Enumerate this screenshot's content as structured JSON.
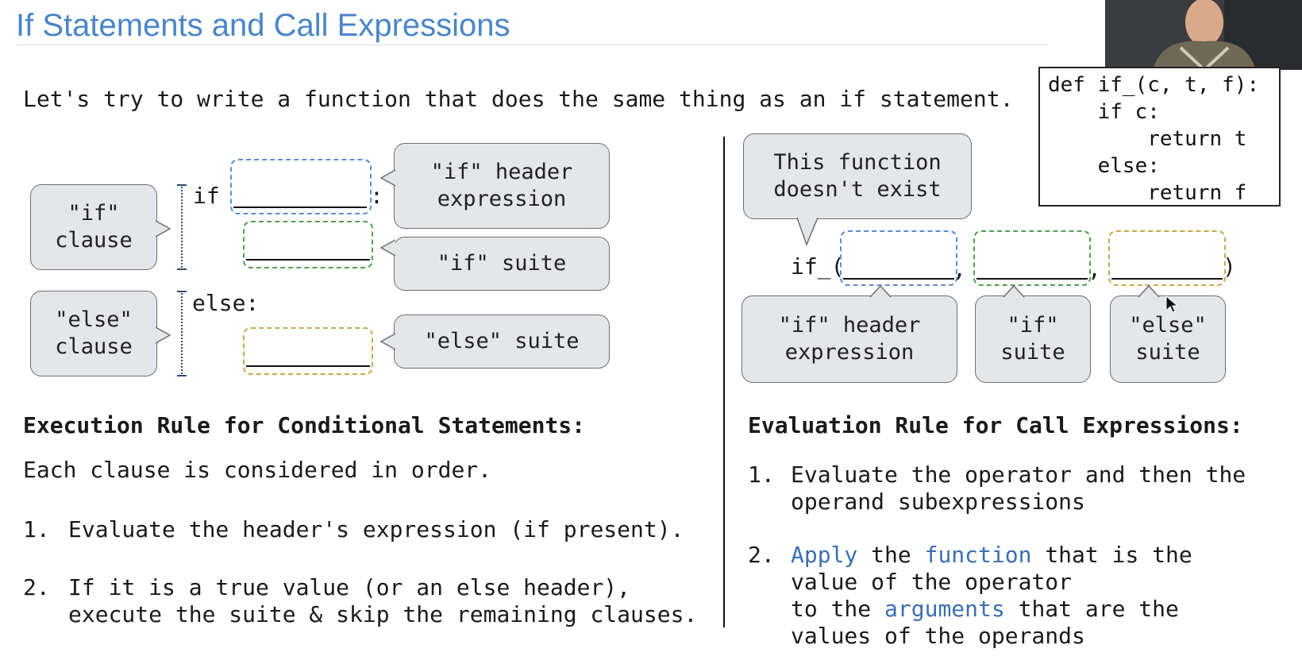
{
  "slide": {
    "title": "If Statements and Call Expressions",
    "intro": "Let's try to write a function that does the same thing as an if statement.",
    "code": "def if_(c, t, f):\n    if c:\n        return t\n    else:\n        return f"
  },
  "left_diagram": {
    "if_keyword": "if",
    "colon": ":",
    "else_keyword": "else:",
    "if_clause_label": "\"if\"\nclause",
    "else_clause_label": "\"else\"\nclause",
    "header_expr_label": "\"if\" header\nexpression",
    "if_suite_label": "\"if\" suite",
    "else_suite_label": "\"else\" suite"
  },
  "right_diagram": {
    "callout": "This function\ndoesn't exist",
    "call_prefix": "if_(",
    "comma": ",",
    "close_paren": ")",
    "header_expr_label": "\"if\" header\nexpression",
    "if_suite_label": "\"if\"\nsuite",
    "else_suite_label": "\"else\"\nsuite"
  },
  "execution_rule": {
    "heading": "Execution Rule for Conditional Statements:",
    "intro": "Each clause is considered in order.",
    "step1_num": "1.",
    "step1": "Evaluate the header's expression (if present).",
    "step2_num": "2.",
    "step2_line1": "If it is a true value (or an else header),",
    "step2_line2": "execute the suite & skip the remaining clauses."
  },
  "evaluation_rule": {
    "heading": "Evaluation Rule for Call Expressions:",
    "step1_num": "1.",
    "step1_line1": "Evaluate the operator and then the",
    "step1_line2": "operand subexpressions",
    "step2_num": "2.",
    "step2_apply": "Apply",
    "step2_the": "the",
    "step2_function": "function",
    "step2_rest1": "that is the",
    "step2_line2": "value of the operator",
    "step2_to_the": "to the",
    "step2_arguments": "arguments",
    "step2_rest3": "that are the",
    "step2_line4": "values of the operands"
  },
  "colors": {
    "title": "#4a86c8",
    "keyword": "#3b6fb0",
    "bubble": "#e4e6e9",
    "blue": "#5b8fd0",
    "green": "#4ea24e",
    "gold": "#caa84a"
  },
  "icons": [
    "presenter-webcam",
    "mouse-cursor-icon"
  ]
}
